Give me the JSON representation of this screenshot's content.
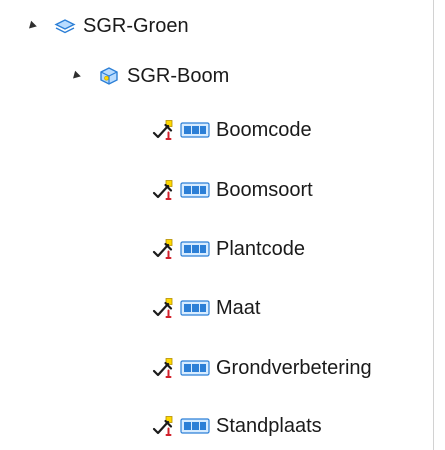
{
  "tree": {
    "group": {
      "label": "SGR-Groen",
      "icon": "group-layer-icon"
    },
    "layer": {
      "label": "SGR-Boom",
      "icon": "feature-layer-icon"
    },
    "fields": [
      {
        "label": "Boomcode"
      },
      {
        "label": "Boomsoort"
      },
      {
        "label": "Plantcode"
      },
      {
        "label": "Maat"
      },
      {
        "label": "Grondverbetering"
      },
      {
        "label": "Standplaats"
      }
    ]
  },
  "colors": {
    "blue_light": "#b9dcff",
    "blue_dark": "#2c7fd6",
    "yellow": "#ffd800",
    "red": "#d11f2a",
    "text": "#1a1a1a"
  }
}
